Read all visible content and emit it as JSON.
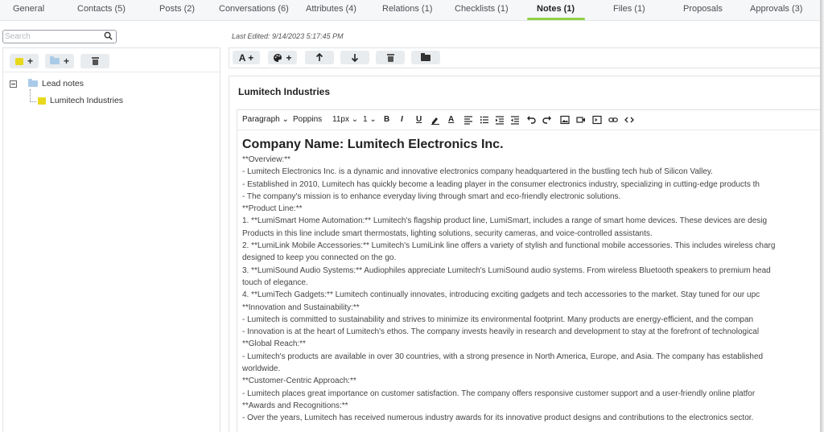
{
  "tabs": [
    {
      "label": "General"
    },
    {
      "label": "Contacts (5)"
    },
    {
      "label": "Posts (2)"
    },
    {
      "label": "Conversations (6)"
    },
    {
      "label": "Attributes (4)"
    },
    {
      "label": "Relations (1)"
    },
    {
      "label": "Checklists (1)"
    },
    {
      "label": "Notes (1)",
      "active": true
    },
    {
      "label": "Files (1)"
    },
    {
      "label": "Proposals"
    },
    {
      "label": "Approvals (3)"
    }
  ],
  "colors": {
    "accent": "#8fd142",
    "note": "#e8d81c",
    "folder": "#aacbe8"
  },
  "search": {
    "placeholder": "Search"
  },
  "left_toolbar": {
    "add_note": "+",
    "add_folder": "+"
  },
  "tree": {
    "folder": "Lead notes",
    "note": "Lumitech Industries"
  },
  "last_edited": "Last Edited: 9/14/2023 5:17:45 PM",
  "right_toolbar": {
    "add_text": "A +",
    "add_style": "+"
  },
  "note": {
    "title": "Lumitech Industries"
  },
  "editor_toolbar": {
    "paragraph": "Paragraph",
    "font": "Poppins",
    "size": "11px",
    "line_height": "1",
    "bold": "B",
    "italic": "I",
    "underline": "U",
    "font_color": "A"
  },
  "content": {
    "heading": "Company Name:  Lumitech Electronics Inc.",
    "lines": [
      "**Overview:**",
      "- Lumitech Electronics Inc. is a dynamic and innovative electronics company headquartered in the bustling tech hub of Silicon Valley.",
      "- Established in 2010, Lumitech has quickly become a leading player in the consumer electronics industry, specializing in cutting-edge products th",
      "- The company's mission is to enhance everyday living through smart and eco-friendly electronic solutions.",
      "**Product Line:**",
      "1. **LumiSmart Home Automation:** Lumitech's flagship product line, LumiSmart, includes a range of smart home devices. These devices are desig",
      "Products in this line include smart thermostats, lighting solutions, security cameras, and voice-controlled assistants.",
      "2. **LumiLink Mobile Accessories:** Lumitech's LumiLink line offers a variety of stylish and functional mobile accessories. This includes wireless charg",
      "designed to keep you connected on the go.",
      "3. **LumiSound Audio Systems:** Audiophiles appreciate Lumitech's LumiSound audio systems. From wireless Bluetooth speakers to premium head",
      "touch of elegance.",
      "4. **LumiTech Gadgets:** Lumitech continually innovates, introducing exciting gadgets and tech accessories to the market. Stay tuned for our upc",
      "**Innovation and Sustainability:**",
      "- Lumitech is committed to sustainability and strives to minimize its environmental footprint. Many products are energy-efficient, and the compan",
      "- Innovation is at the heart of Lumitech's ethos. The company invests heavily in research and development to stay at the forefront of technological",
      "**Global Reach:**",
      "- Lumitech's products are available in over 30 countries, with a strong presence in North America, Europe, and Asia. The company has established",
      "worldwide.",
      "**Customer-Centric Approach:**",
      "- Lumitech places great importance on customer satisfaction. The company offers responsive customer support and a user-friendly online platfor",
      "**Awards and Recognitions:**",
      "- Over the years, Lumitech has received numerous industry awards for its innovative product designs and contributions to the electronics sector."
    ]
  }
}
